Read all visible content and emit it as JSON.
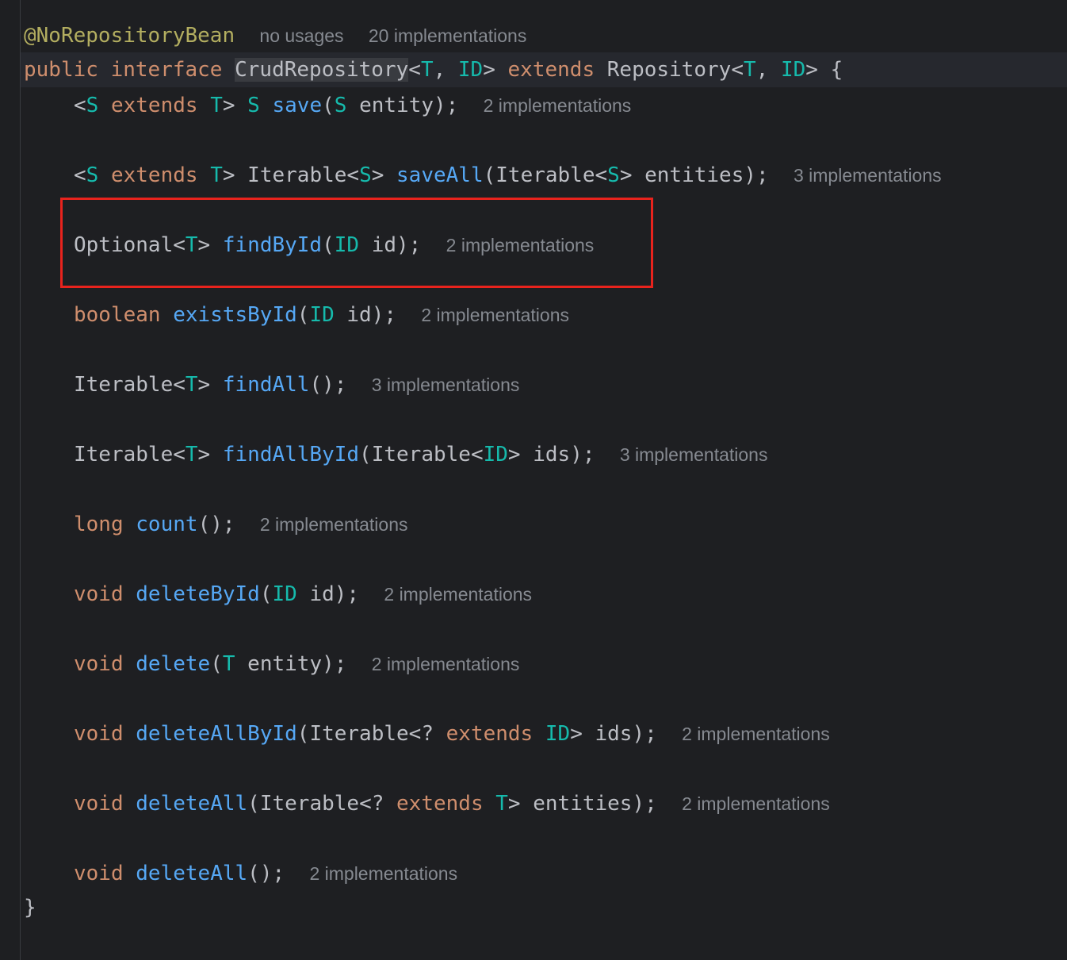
{
  "colors": {
    "background": "#1e1f22",
    "keyword": "#cf8e6d",
    "type_param": "#16baac",
    "method": "#56a8f5",
    "annotation": "#b3ae60",
    "plain": "#bcbec4",
    "hint": "#868a91",
    "highlight_box": "#e8231d"
  },
  "header": {
    "annotation": "@NoRepositoryBean",
    "usages_hint": "no usages",
    "impl_hint": "20 implementations"
  },
  "declaration": {
    "public": "public",
    "interface": "interface",
    "name": "CrudRepository",
    "t": "T",
    "id": "ID",
    "extends": "extends",
    "parent": "Repository",
    "open_brace": "{"
  },
  "methods": {
    "save": {
      "s": "S",
      "extends": "extends",
      "t": "T",
      "ret": "S",
      "name": "save",
      "ptype": "S",
      "param": "entity",
      "hint": "2 implementations"
    },
    "saveAll": {
      "s": "S",
      "extends": "extends",
      "t": "T",
      "ret": "Iterable",
      "rs": "S",
      "name": "saveAll",
      "ptype": "Iterable",
      "ps": "S",
      "param": "entities",
      "hint": "3 implementations"
    },
    "findById": {
      "ret": "Optional",
      "rt": "T",
      "name": "findById",
      "ptype": "ID",
      "param": "id",
      "hint": "2 implementations"
    },
    "existsById": {
      "ret": "boolean",
      "name": "existsById",
      "ptype": "ID",
      "param": "id",
      "hint": "2 implementations"
    },
    "findAll": {
      "ret": "Iterable",
      "rt": "T",
      "name": "findAll",
      "hint": "3 implementations"
    },
    "findAllById": {
      "ret": "Iterable",
      "rt": "T",
      "name": "findAllById",
      "ptype": "Iterable",
      "pid": "ID",
      "param": "ids",
      "hint": "3 implementations"
    },
    "count": {
      "ret": "long",
      "name": "count",
      "hint": "2 implementations"
    },
    "deleteById": {
      "ret": "void",
      "name": "deleteById",
      "ptype": "ID",
      "param": "id",
      "hint": "2 implementations"
    },
    "delete": {
      "ret": "void",
      "name": "delete",
      "ptype": "T",
      "param": "entity",
      "hint": "2 implementations"
    },
    "deleteAllById": {
      "ret": "void",
      "name": "deleteAllById",
      "ptype": "Iterable",
      "extends": "extends",
      "pid": "ID",
      "param": "ids",
      "hint": "2 implementations"
    },
    "deleteAllEntities": {
      "ret": "void",
      "name": "deleteAll",
      "ptype": "Iterable",
      "extends": "extends",
      "pt": "T",
      "param": "entities",
      "hint": "2 implementations"
    },
    "deleteAll": {
      "ret": "void",
      "name": "deleteAll",
      "hint": "2 implementations"
    }
  },
  "close_brace": "}"
}
